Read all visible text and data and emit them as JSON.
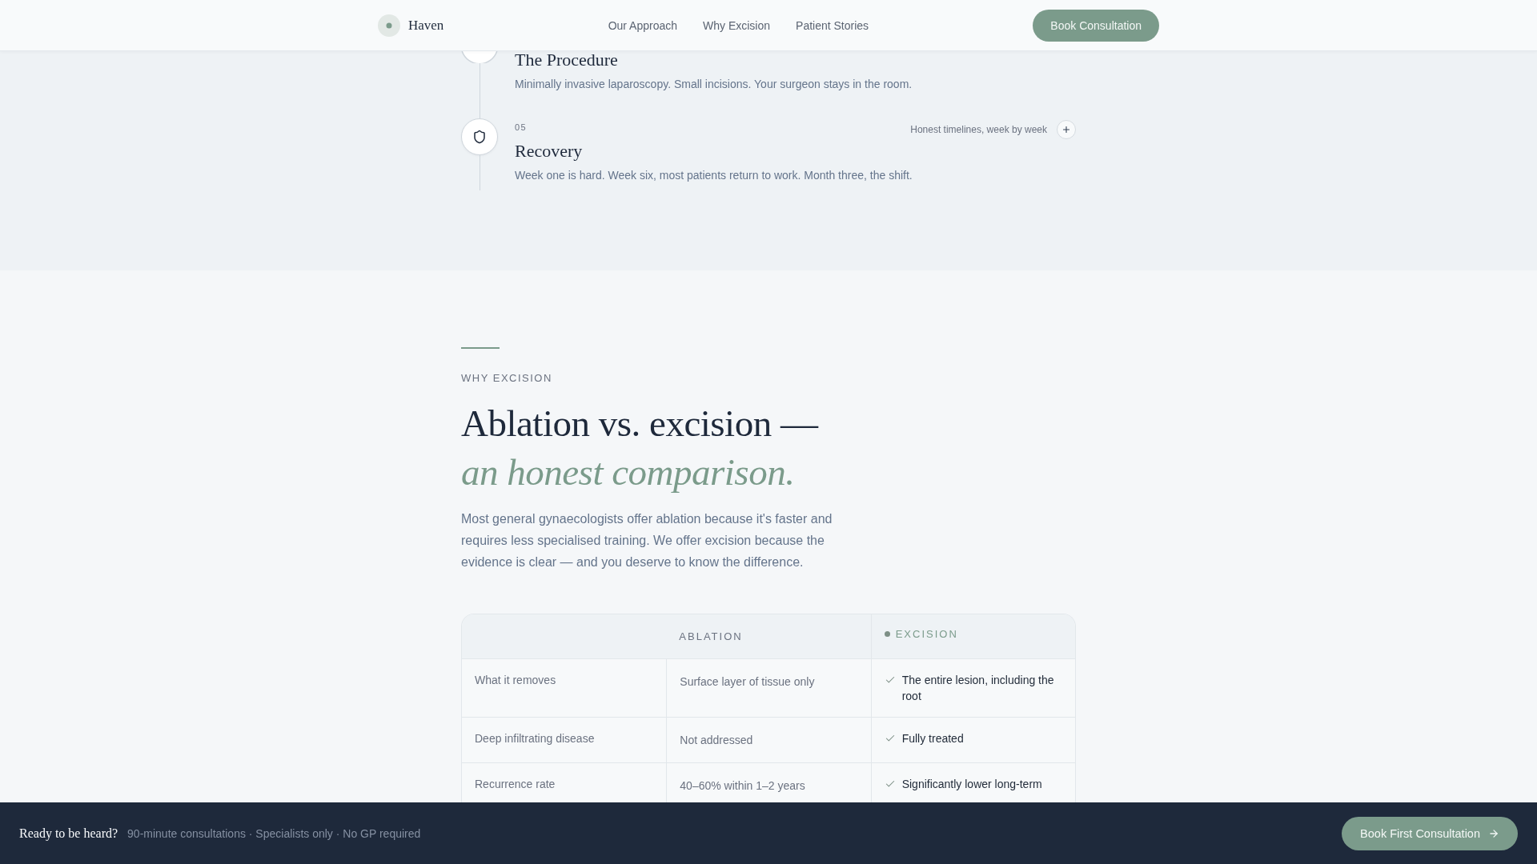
{
  "header": {
    "brand": "Haven",
    "nav": [
      {
        "label": "Our Approach"
      },
      {
        "label": "Why Excision"
      },
      {
        "label": "Patient Stories"
      }
    ],
    "button": "Book Consultation"
  },
  "timeline": {
    "items": [
      {
        "title": "The Procedure",
        "description": "Minimally invasive laparoscopy. Small incisions. Your surgeon stays in the room."
      },
      {
        "number": "05",
        "title": "Recovery",
        "description": "Week one is hard. Week six, most patients return to work. Month three, the shift.",
        "note": "Honest timelines, week by week",
        "expanded": false
      }
    ]
  },
  "comparison": {
    "eyebrow": "WHY EXCISION",
    "heading": "Ablation vs. excision — *an honest comparison.*",
    "intro": "Most general gynaecologists offer ablation because it's faster and requires less specialised training. We offer excision because the evidence is clear — and you deserve to know the difference.",
    "table": {
      "columns": [
        {
          "label": "ABLATION",
          "kind": "standard"
        },
        {
          "label": "EXCISION",
          "kind": "recommended"
        }
      ],
      "rows": [
        {
          "label": "What it removes",
          "cells": [
            "Surface layer of tissue only",
            "The entire lesion, including the root"
          ]
        },
        {
          "label": "Deep infiltrating disease",
          "cells": [
            "Not addressed",
            "Fully treated"
          ]
        },
        {
          "label": "Recurrence rate",
          "cells": [
            "40–60% within 1–2 years",
            "Significantly lower long-term"
          ]
        }
      ]
    }
  },
  "cta_bar": {
    "title": "Ready to be heard?",
    "details": "90-minute consultations · Specialists only · No GP required",
    "button": "Book First Consultation"
  }
}
